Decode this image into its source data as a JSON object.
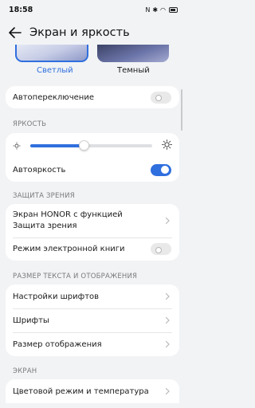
{
  "status_bar": {
    "time": "18:58",
    "icons": "NFC · BT · Wi-Fi · battery"
  },
  "header": {
    "title": "Экран и яркость"
  },
  "theme": {
    "light_label": "Светлый",
    "dark_label": "Темный",
    "selected": "light"
  },
  "auto_switch": {
    "label": "Автопереключение",
    "on": false
  },
  "brightness": {
    "section": "ЯРКОСТЬ",
    "level": 0.44,
    "auto_label": "Автояркость",
    "auto_on": true
  },
  "eye_protection": {
    "section": "ЗАЩИТА ЗРЕНИЯ",
    "honor_label": "Экран HONOR с функцией Защита зрения",
    "ebook_label": "Режим электронной книги",
    "ebook_on": false
  },
  "text_display": {
    "section": "РАЗМЕР ТЕКСТА И ОТОБРАЖЕНИЯ",
    "font_settings": "Настройки шрифтов",
    "fonts": "Шрифты",
    "display_size": "Размер отображения"
  },
  "screen": {
    "section": "ЭКРАН",
    "color_mode": "Цветовой режим и температура"
  },
  "colors": {
    "accent": "#2f6fde",
    "background": "#f1f3f5"
  }
}
